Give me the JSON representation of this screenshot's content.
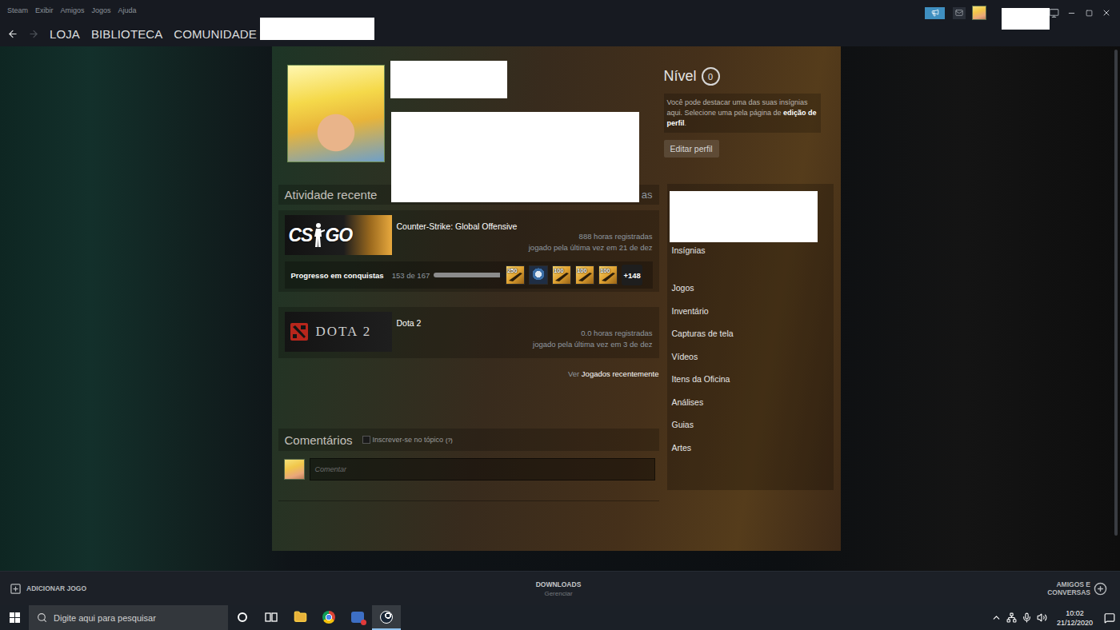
{
  "window": {
    "menu": [
      "Steam",
      "Exibir",
      "Amigos",
      "Jogos",
      "Ajuda"
    ],
    "announcements_active": true
  },
  "nav": {
    "back_enabled": true,
    "forward_enabled": false,
    "tabs": [
      {
        "label": "LOJA",
        "selected": false
      },
      {
        "label": "BIBLIOTECA",
        "selected": false
      },
      {
        "label": "COMUNIDADE",
        "selected": false
      }
    ]
  },
  "profile": {
    "level_label": "Nível",
    "level": "0",
    "hint": "Você pode destacar uma das suas insígnias aqui. Selecione uma pela página de ",
    "hint_link": "edição de perfil",
    "hint_end": ".",
    "edit_button": "Editar perfil"
  },
  "activity": {
    "title": "Atividade recente",
    "header_right": "as",
    "games": [
      {
        "name": "Counter-Strike: Global Offensive",
        "hours": "888 horas registradas",
        "last_played": "jogado pela última vez em 21 de dez",
        "banner": {
          "kind": "csgo",
          "text": [
            "CS",
            "GO"
          ]
        },
        "achievements": {
          "label": "Progresso em conquistas",
          "count": "153 de 167",
          "level": 0.916,
          "icons": [
            {
              "kind": "rank",
              "label": "250"
            },
            {
              "kind": "medal"
            },
            {
              "kind": "rank",
              "label": "100"
            },
            {
              "kind": "rank",
              "label": "100"
            },
            {
              "kind": "rank",
              "label": "100"
            }
          ],
          "more": "+148"
        }
      },
      {
        "name": "Dota 2",
        "hours": "0.0 horas registradas",
        "last_played": "jogado pela última vez em 3 de dez",
        "banner": {
          "kind": "dota",
          "text": [
            "DOTA 2"
          ]
        }
      }
    ],
    "footer_prefix": "Ver",
    "footer_link": "Jogados recentemente"
  },
  "comments": {
    "title": "Comentários",
    "subscribe": {
      "label": "Inscrever-se no tópico",
      "checked": false
    },
    "help": "(?)",
    "placeholder": "Comentar"
  },
  "sidebar": {
    "badges_label": "Insígnias",
    "items": [
      "Jogos",
      "Inventário",
      "Capturas de tela",
      "Vídeos",
      "Itens da Oficina",
      "Análises",
      "Guias",
      "Artes"
    ]
  },
  "bottom_bar": {
    "add_game": "ADICIONAR JOGO",
    "downloads": "DOWNLOADS",
    "downloads_sub": "Gerenciar",
    "friends": [
      "AMIGOS E",
      "CONVERSAS"
    ]
  },
  "taskbar": {
    "search_placeholder": "Digite aqui para pesquisar",
    "apps": [
      {
        "kind": "cortana",
        "active": false
      },
      {
        "kind": "taskview",
        "active": false
      },
      {
        "kind": "explorer",
        "active": false
      },
      {
        "kind": "chrome",
        "active": false
      },
      {
        "kind": "messenger",
        "active": false
      },
      {
        "kind": "steam",
        "active": true
      }
    ],
    "time": "10:02",
    "date": "21/12/2020"
  }
}
